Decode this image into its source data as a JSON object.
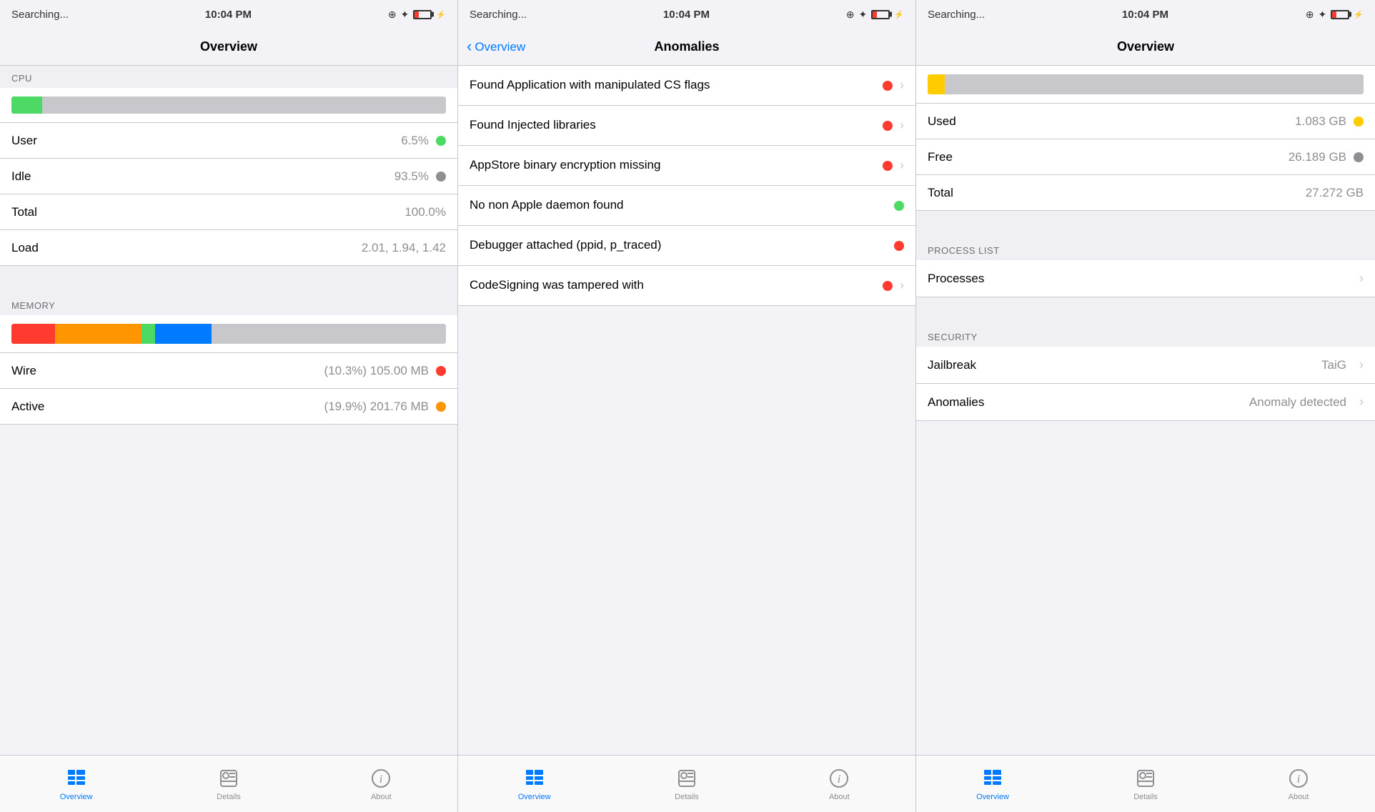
{
  "panels": [
    {
      "id": "panel1",
      "statusBar": {
        "left": "Searching...",
        "center": "10:04 PM",
        "right": "🔒 ✦ ⚡"
      },
      "navTitle": "Overview",
      "navBack": null,
      "sections": [
        {
          "type": "section-header",
          "label": "CPU"
        },
        {
          "type": "progress-bar",
          "color": "green",
          "percent": 7
        },
        {
          "type": "stat",
          "label": "User",
          "value": "6.5%",
          "dot": "green"
        },
        {
          "type": "stat",
          "label": "Idle",
          "value": "93.5%",
          "dot": "gray"
        },
        {
          "type": "stat",
          "label": "Total",
          "value": "100.0%",
          "dot": null
        },
        {
          "type": "stat",
          "label": "Load",
          "value": "2.01, 1.94, 1.42",
          "dot": null
        },
        {
          "type": "spacer"
        },
        {
          "type": "section-header",
          "label": "MEMORY"
        },
        {
          "type": "memory-bar"
        },
        {
          "type": "stat",
          "label": "Wire",
          "value": "(10.3%) 105.00 MB",
          "dot": "red"
        },
        {
          "type": "stat",
          "label": "Active",
          "value": "(19.9%) 201.76 MB",
          "dot": "orange"
        }
      ],
      "tabs": [
        {
          "label": "Overview",
          "active": true,
          "icon": "overview"
        },
        {
          "label": "Details",
          "active": false,
          "icon": "details"
        },
        {
          "label": "About",
          "active": false,
          "icon": "about"
        }
      ]
    },
    {
      "id": "panel2",
      "statusBar": {
        "left": "Searching...",
        "center": "10:04 PM",
        "right": "🔒 ✦ ⚡"
      },
      "navTitle": "Anomalies",
      "navBack": "Overview",
      "anomalies": [
        {
          "text": "Found Application with manipulated CS flags",
          "dot": "red",
          "hasChevron": true
        },
        {
          "text": "Found Injected libraries",
          "dot": "red",
          "hasChevron": true
        },
        {
          "text": "AppStore binary encryption missing",
          "dot": "red",
          "hasChevron": true
        },
        {
          "text": "No non Apple daemon found",
          "dot": "green",
          "hasChevron": false
        },
        {
          "text": "Debugger attached (ppid, p_traced)",
          "dot": "red",
          "hasChevron": false
        },
        {
          "text": "CodeSigning was tampered with",
          "dot": "red",
          "hasChevron": true
        }
      ],
      "tabs": [
        {
          "label": "Overview",
          "active": true,
          "icon": "overview"
        },
        {
          "label": "Details",
          "active": false,
          "icon": "details"
        },
        {
          "label": "About",
          "active": false,
          "icon": "about"
        }
      ]
    },
    {
      "id": "panel3",
      "statusBar": {
        "left": "Searching...",
        "center": "10:04 PM",
        "right": "🔒 ✦ ⚡"
      },
      "navTitle": "Overview",
      "navBack": null,
      "sections": [
        {
          "type": "storage-bar"
        },
        {
          "type": "stat",
          "label": "Used",
          "value": "1.083 GB",
          "dot": "yellow"
        },
        {
          "type": "stat",
          "label": "Free",
          "value": "26.189 GB",
          "dot": "gray"
        },
        {
          "type": "stat",
          "label": "Total",
          "value": "27.272 GB",
          "dot": null
        },
        {
          "type": "spacer"
        },
        {
          "type": "section-header",
          "label": "PROCESS LIST"
        },
        {
          "type": "nav-row",
          "label": "Processes",
          "value": null
        },
        {
          "type": "spacer"
        },
        {
          "type": "section-header",
          "label": "SECURITY"
        },
        {
          "type": "nav-row",
          "label": "Jailbreak",
          "value": "TaiG"
        },
        {
          "type": "nav-row",
          "label": "Anomalies",
          "value": "Anomaly detected"
        }
      ],
      "tabs": [
        {
          "label": "Overview",
          "active": true,
          "icon": "overview"
        },
        {
          "label": "Details",
          "active": false,
          "icon": "details"
        },
        {
          "label": "About",
          "active": false,
          "icon": "about"
        }
      ]
    }
  ]
}
